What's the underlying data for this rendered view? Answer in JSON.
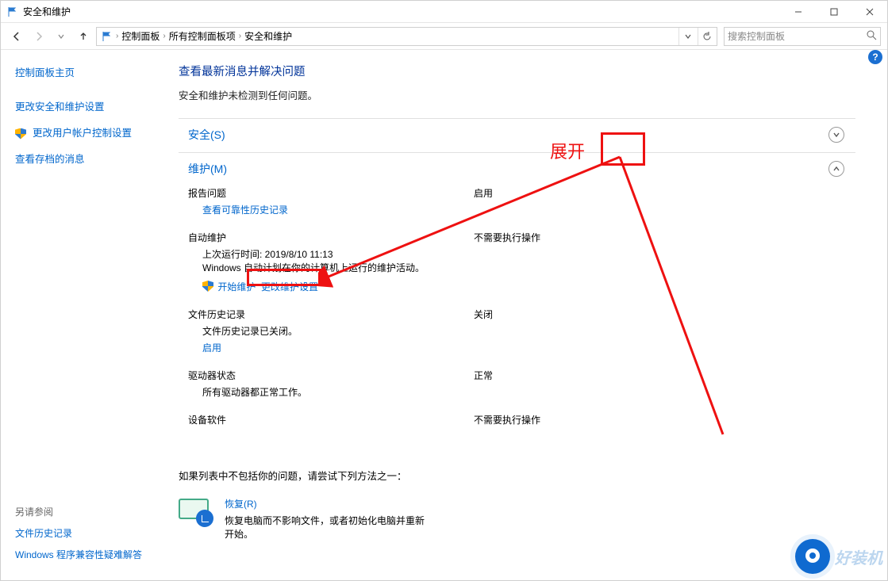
{
  "window": {
    "title": "安全和维护"
  },
  "nav": {
    "back": "←",
    "forward": "→",
    "up": "↑"
  },
  "breadcrumb": {
    "root": "控制面板",
    "mid": "所有控制面板项",
    "leaf": "安全和维护"
  },
  "search": {
    "placeholder": "搜索控制面板"
  },
  "sidebar": {
    "home": "控制面板主页",
    "links": {
      "change_security": "更改安全和维护设置",
      "change_uac": "更改用户帐户控制设置",
      "view_archived": "查看存档的消息"
    },
    "see_also_heading": "另请参阅",
    "see_also": {
      "file_history": "文件历史记录",
      "compat_troubleshoot": "Windows 程序兼容性疑难解答"
    }
  },
  "content": {
    "heading": "查看最新消息并解决问题",
    "subtext": "安全和维护未检测到任何问题。",
    "security_section": "安全(S)",
    "maintenance_section": "维护(M)",
    "report": {
      "label": "报告问题",
      "status": "启用",
      "link": "查看可靠性历史记录"
    },
    "auto_maint": {
      "label": "自动维护",
      "status": "不需要执行操作",
      "last_run": "上次运行时间: 2019/8/10 11:13",
      "desc": "Windows 自动计划在你的计算机上运行的维护活动。",
      "start_link": "开始维护",
      "change_link": "更改维护设置"
    },
    "file_history": {
      "label": "文件历史记录",
      "status": "关闭",
      "desc": "文件历史记录已关闭。",
      "enable_link": "启用"
    },
    "drive_status": {
      "label": "驱动器状态",
      "status": "正常",
      "desc": "所有驱动器都正常工作。"
    },
    "device_software": {
      "label": "设备软件",
      "status": "不需要执行操作"
    },
    "footer_note": "如果列表中不包括你的问题，请尝试下列方法之一：",
    "recovery": {
      "title": "恢复(R)",
      "desc": "恢复电脑而不影响文件，或者初始化电脑并重新开始。"
    }
  },
  "annotation": {
    "expand_label": "展开"
  },
  "watermark": {
    "text": "好装机"
  }
}
